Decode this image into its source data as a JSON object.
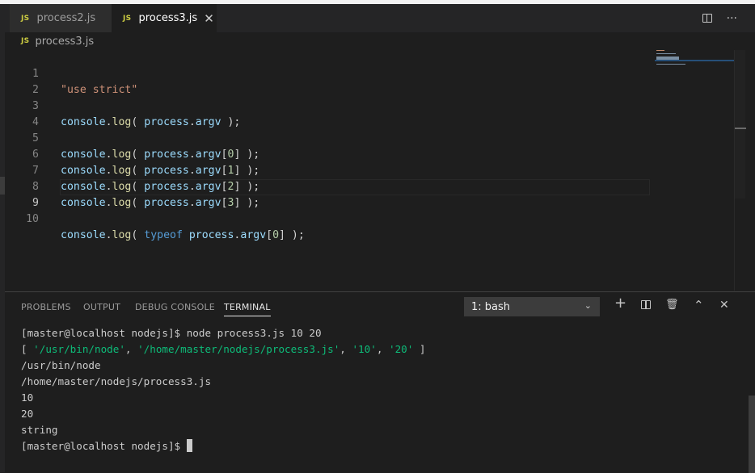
{
  "tabs": [
    {
      "label": "process2.js",
      "icon": "JS",
      "active": false
    },
    {
      "label": "process3.js",
      "icon": "JS",
      "active": true
    }
  ],
  "tab_close_glyph": "✕",
  "tab_actions": {
    "more_glyph": "···"
  },
  "breadcrumb": {
    "icon": "JS",
    "file": "process3.js"
  },
  "editor": {
    "line_numbers": [
      "1",
      "2",
      "3",
      "4",
      "5",
      "6",
      "7",
      "8",
      "9",
      "10"
    ],
    "current_line": "9",
    "lines": {
      "l1": {
        "str": "\"use strict\""
      },
      "l3": {
        "obj": "console",
        "fn": "log",
        "open": "( ",
        "var": "process",
        "prop": "argv",
        "close": " );"
      },
      "l5": {
        "obj": "console",
        "fn": "log",
        "open": "( ",
        "var": "process",
        "prop": "argv",
        "idx": "0",
        "close": "] );"
      },
      "l6": {
        "obj": "console",
        "fn": "log",
        "open": "( ",
        "var": "process",
        "prop": "argv",
        "idx": "1",
        "close": "] );"
      },
      "l7": {
        "obj": "console",
        "fn": "log",
        "open": "( ",
        "var": "process",
        "prop": "argv",
        "idx": "2",
        "close": "] );"
      },
      "l8": {
        "obj": "console",
        "fn": "log",
        "open": "( ",
        "var": "process",
        "prop": "argv",
        "idx": "3",
        "close": "] );"
      },
      "l10": {
        "obj": "console",
        "fn": "log",
        "open": "( ",
        "kw": "typeof",
        "var": "process",
        "prop": "argv",
        "idx": "0",
        "close": "] );"
      }
    }
  },
  "panel": {
    "tabs": [
      "PROBLEMS",
      "OUTPUT",
      "DEBUG CONSOLE",
      "TERMINAL"
    ],
    "active_tab": "TERMINAL",
    "terminal_select": "1: bash",
    "action_glyphs": {
      "add": "+",
      "delete": "🗑",
      "maximize": "⌃",
      "close": "✕"
    }
  },
  "terminal": {
    "cmd": "[master@localhost nodejs]$ node process3.js 10 20",
    "arr_open": "[ ",
    "arr_items": [
      "'/usr/bin/node'",
      "'/home/master/nodejs/process3.js'",
      "'10'",
      "'20'"
    ],
    "arr_sep": ", ",
    "arr_close": " ]",
    "out": [
      "/usr/bin/node",
      "/home/master/nodejs/process3.js",
      "10",
      "20",
      "string"
    ],
    "prompt": "[master@localhost nodejs]$ "
  },
  "colors": {
    "background": "#1e1e1e",
    "string": "#ce9178",
    "variable": "#9cdcfe",
    "function": "#dcdcaa",
    "number": "#b5cea8",
    "keyword": "#569cd6",
    "terminal_green": "#0dbc79"
  }
}
